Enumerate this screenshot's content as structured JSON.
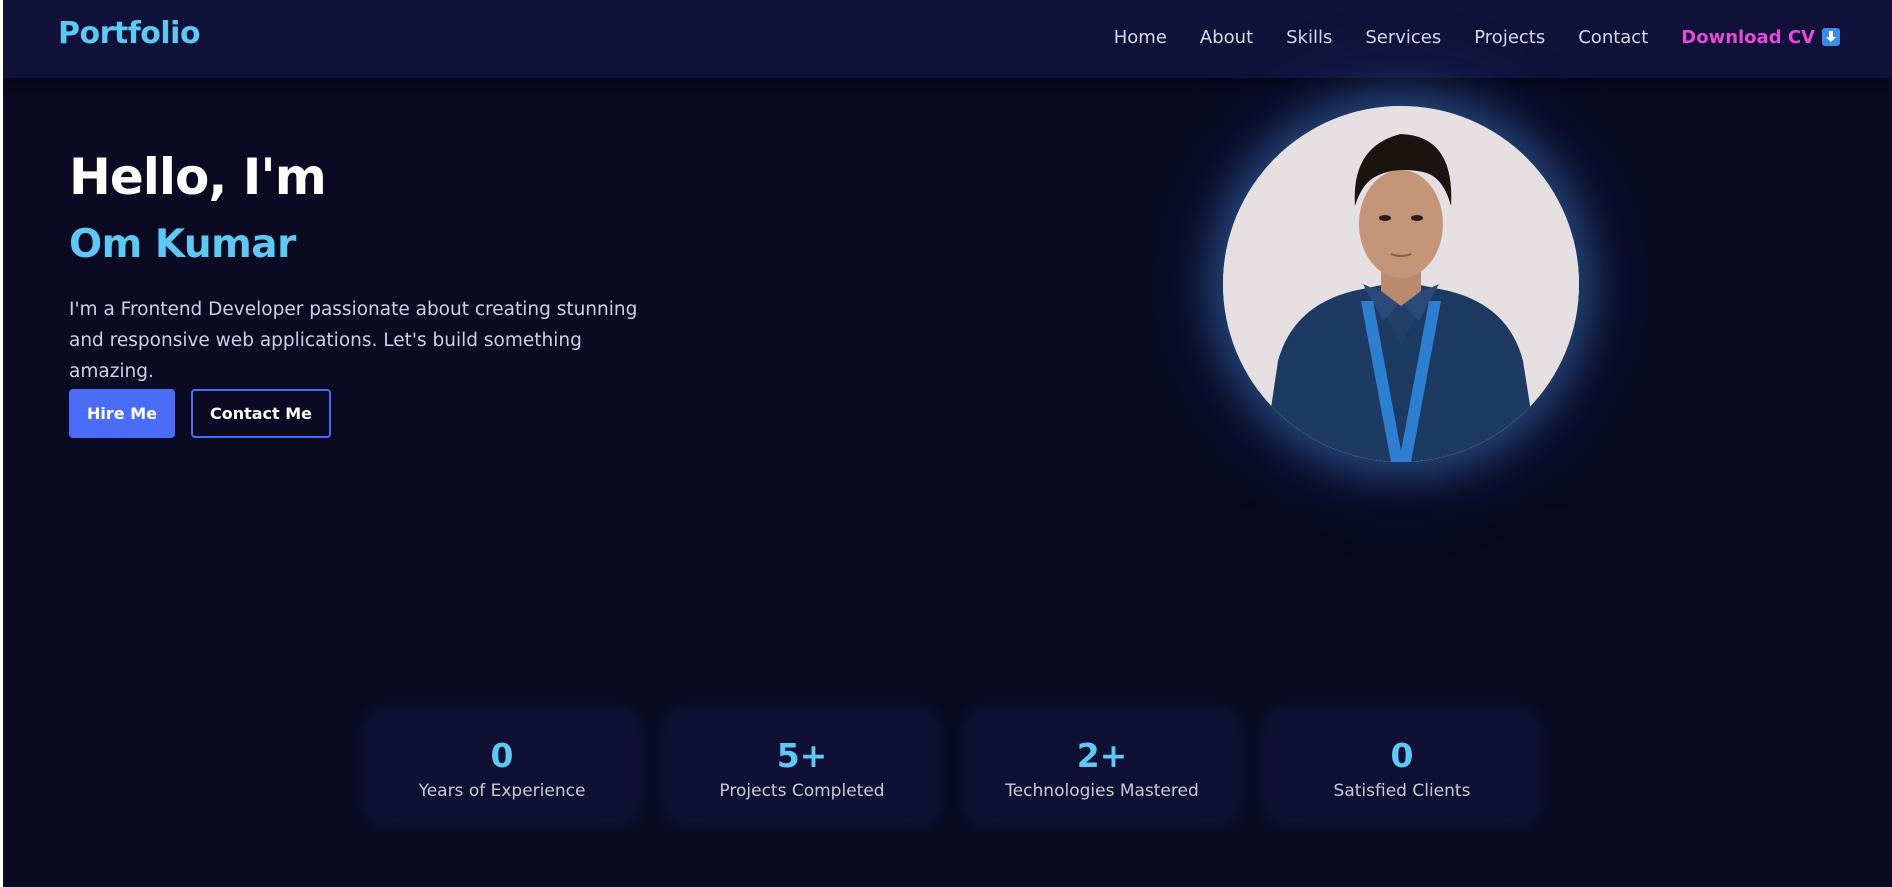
{
  "nav": {
    "logo": "Portfolio",
    "links": [
      "Home",
      "About",
      "Skills",
      "Services",
      "Projects",
      "Contact"
    ],
    "download_cv": "Download CV",
    "download_icon": "download-arrow-icon"
  },
  "hero": {
    "greeting": "Hello, I'm",
    "name": "Om Kumar",
    "description": "I'm a Frontend Developer passionate about creating stunning and responsive web applications. Let's build something amazing.",
    "hire_button": "Hire Me",
    "contact_button": "Contact Me"
  },
  "stats": [
    {
      "value": "0",
      "label": "Years of Experience"
    },
    {
      "value": "5+",
      "label": "Projects Completed"
    },
    {
      "value": "2+",
      "label": "Technologies Mastered"
    },
    {
      "value": "0",
      "label": "Satisfied Clients"
    }
  ],
  "colors": {
    "background": "#0a0a22",
    "navbar": "#11123a",
    "accent_cyan": "#5ec8f2",
    "accent_blue": "#4a6cf7",
    "accent_pink": "#e44bd6"
  }
}
